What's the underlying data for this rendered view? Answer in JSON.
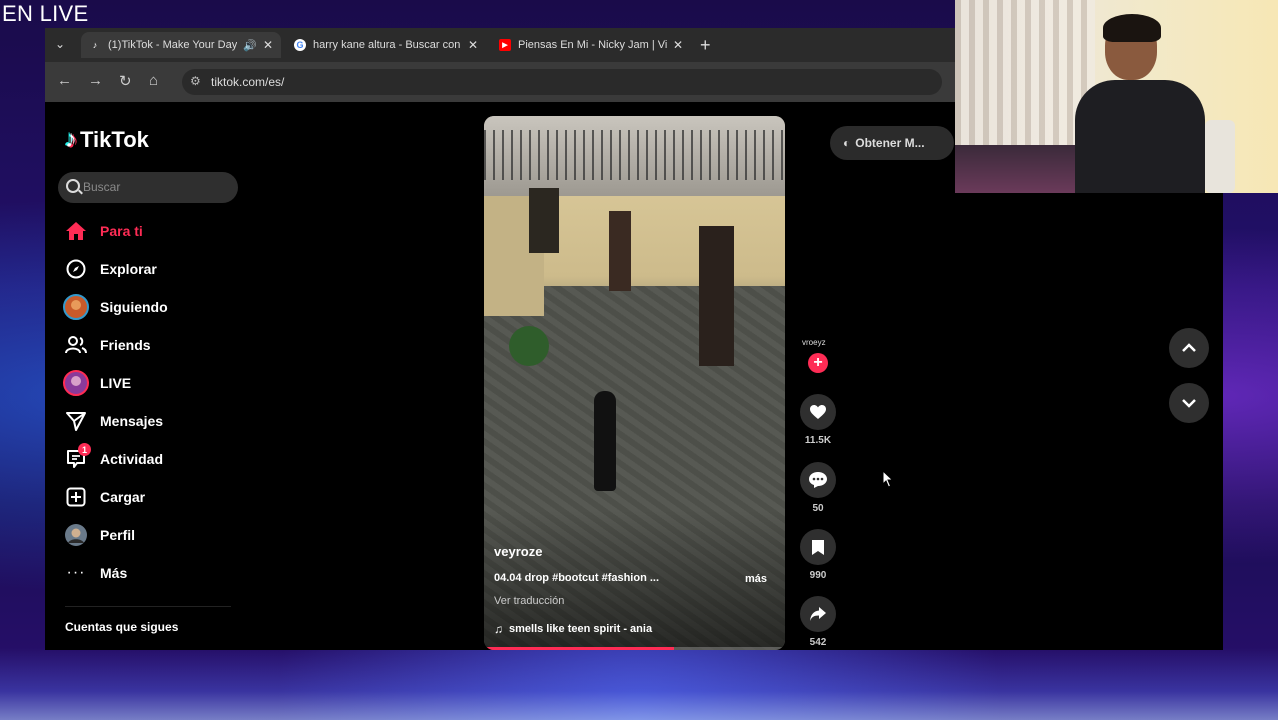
{
  "overlay": {
    "stream_title": "EN LIVE"
  },
  "browser": {
    "tabs": [
      {
        "title": "(1)TikTok - Make Your Day",
        "favicon": "tiktok-icon",
        "muted_icon": "speaker-icon",
        "active": true
      },
      {
        "title": "harry kane altura - Buscar con G",
        "favicon": "google-icon",
        "active": false
      },
      {
        "title": "Piensas En Mi - Nicky Jam | Vid",
        "favicon": "youtube-icon",
        "active": false
      }
    ],
    "url": "tiktok.com/es/"
  },
  "tiktok": {
    "brand": "TikTok",
    "search_placeholder": "Buscar",
    "nav": [
      {
        "label": "Para ti",
        "icon": "home-icon",
        "active": true
      },
      {
        "label": "Explorar",
        "icon": "compass-icon"
      },
      {
        "label": "Siguiendo",
        "icon": "following-avatar"
      },
      {
        "label": "Friends",
        "icon": "friends-icon"
      },
      {
        "label": "LIVE",
        "icon": "live-avatar"
      },
      {
        "label": "Mensajes",
        "icon": "send-icon"
      },
      {
        "label": "Actividad",
        "icon": "activity-icon",
        "badge": "1"
      },
      {
        "label": "Cargar",
        "icon": "upload-icon"
      },
      {
        "label": "Perfil",
        "icon": "profile-avatar"
      },
      {
        "label": "Más",
        "icon": "more-icon"
      }
    ],
    "following_title": "Cuentas que sigues",
    "get_app": "Obtener M...",
    "video": {
      "author": "veyroze",
      "description": "04.04 drop #bootcut #fashion ...",
      "more": "más",
      "translate": "Ver traducción",
      "music": "smells like teen spirit - ania",
      "progress": 0.63
    },
    "actions": {
      "author_handle": "vroeyz",
      "likes": "11.5K",
      "comments": "50",
      "saves": "990",
      "shares": "542"
    }
  },
  "colors": {
    "accent": "#fe2c55",
    "background": "#000000",
    "chrome_tab": "#3a3a3a"
  }
}
